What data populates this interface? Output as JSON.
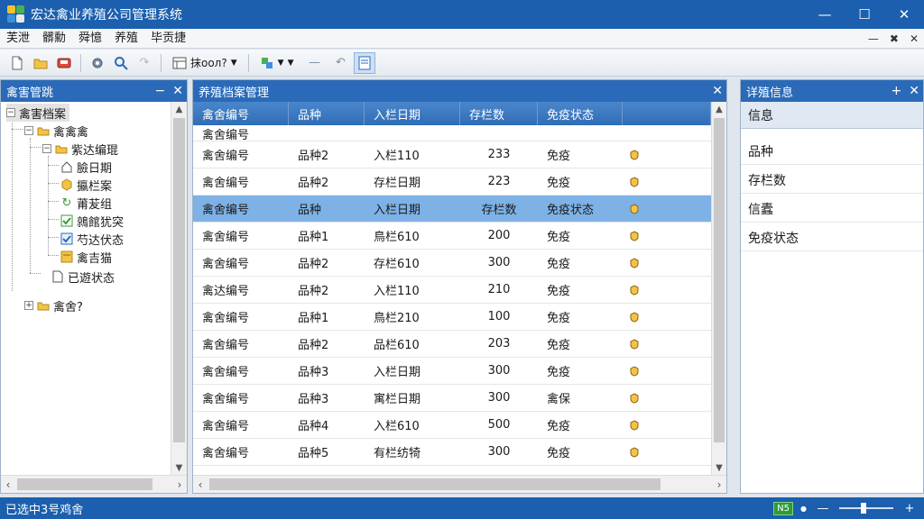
{
  "app": {
    "title": "宏达禽业养殖公司管理系统"
  },
  "menu": {
    "items": [
      "芙泄",
      "髒勳",
      "舜憶",
      "养殖",
      "毕贡捷"
    ]
  },
  "toolbar": {
    "combo_label": "抹ooл?",
    "colors": {
      "accent": "#1b5fae",
      "header": "#2a6ab8"
    }
  },
  "left_panel": {
    "title": "禽害管跳",
    "tree": [
      {
        "label": "禽害档案",
        "icon": "none",
        "level": 0,
        "toggle": "−"
      },
      {
        "label": "禽禽禽",
        "icon": "folder-icon",
        "level": 1,
        "toggle": "−"
      },
      {
        "label": "紫达编琨",
        "icon": "folder-icon",
        "level": 2,
        "toggle": "−"
      },
      {
        "label": "臉日期",
        "icon": "home-icon",
        "level": 3
      },
      {
        "label": "攍栏案",
        "icon": "hexagon-icon",
        "level": 3
      },
      {
        "label": "莆苃组",
        "icon": "refresh-icon",
        "level": 3
      },
      {
        "label": "鶁館犹突",
        "icon": "checkbox-icon",
        "level": 3
      },
      {
        "label": "芍达伏态",
        "icon": "check-shield-icon",
        "level": 3
      },
      {
        "label": "禽吉猫",
        "icon": "note-icon",
        "level": 3
      },
      {
        "label": "已遊状态",
        "icon": "document-icon",
        "level": 2
      },
      {
        "label": "禽舍?",
        "icon": "folder-icon",
        "level": 1,
        "toggle": "+"
      }
    ]
  },
  "center_panel": {
    "title": "养殖档案管理",
    "columns": [
      "禽舍编号",
      "品种",
      "入栏日期",
      "存栏数",
      "免疫状态"
    ],
    "partial_row": "禽舍编号",
    "rows": [
      {
        "id": "禽舍编号",
        "breed": "品种2",
        "date": "入栏110",
        "stock": "233",
        "vacc": "免疫",
        "selected": false
      },
      {
        "id": "禽舍编号",
        "breed": "品种2",
        "date": "存栏日期",
        "stock": "223",
        "vacc": "免疫",
        "selected": false
      },
      {
        "id": "禽舍编号",
        "breed": "品种",
        "date": "入栏日期",
        "stock": "存栏数",
        "vacc": "免疫状态",
        "selected": true
      },
      {
        "id": "禽舍编号",
        "breed": "品种1",
        "date": "鳥栏610",
        "stock": "200",
        "vacc": "免疫",
        "selected": false
      },
      {
        "id": "禽舍编号",
        "breed": "品种2",
        "date": "存栏610",
        "stock": "300",
        "vacc": "免疫",
        "selected": false
      },
      {
        "id": "禽达编号",
        "breed": "品种2",
        "date": "入栏110",
        "stock": "210",
        "vacc": "免疫",
        "selected": false
      },
      {
        "id": "禽舍编号",
        "breed": "品种1",
        "date": "鳥栏210",
        "stock": "100",
        "vacc": "免疫",
        "selected": false
      },
      {
        "id": "禽舍编号",
        "breed": "品种2",
        "date": "品栏610",
        "stock": "203",
        "vacc": "免疫",
        "selected": false
      },
      {
        "id": "禽舍编号",
        "breed": "品种3",
        "date": "入栏日期",
        "stock": "300",
        "vacc": "免疫",
        "selected": false
      },
      {
        "id": "禽舍编号",
        "breed": "品种3",
        "date": "寓栏日期",
        "stock": "300",
        "vacc": "禽保",
        "selected": false
      },
      {
        "id": "禽舍编号",
        "breed": "品种4",
        "date": "入栏610",
        "stock": "500",
        "vacc": "免疫",
        "selected": false
      },
      {
        "id": "禽舍编号",
        "breed": "品种5",
        "date": "有栏纺犄",
        "stock": "300",
        "vacc": "免疫",
        "selected": false
      }
    ]
  },
  "right_panel": {
    "title": "详殖信息",
    "header": "信息",
    "fields": [
      "品种",
      "存栏数",
      "信蠹",
      "免疫状态"
    ]
  },
  "status": {
    "text": "已选中3号鸡舍",
    "badge": "N5"
  }
}
